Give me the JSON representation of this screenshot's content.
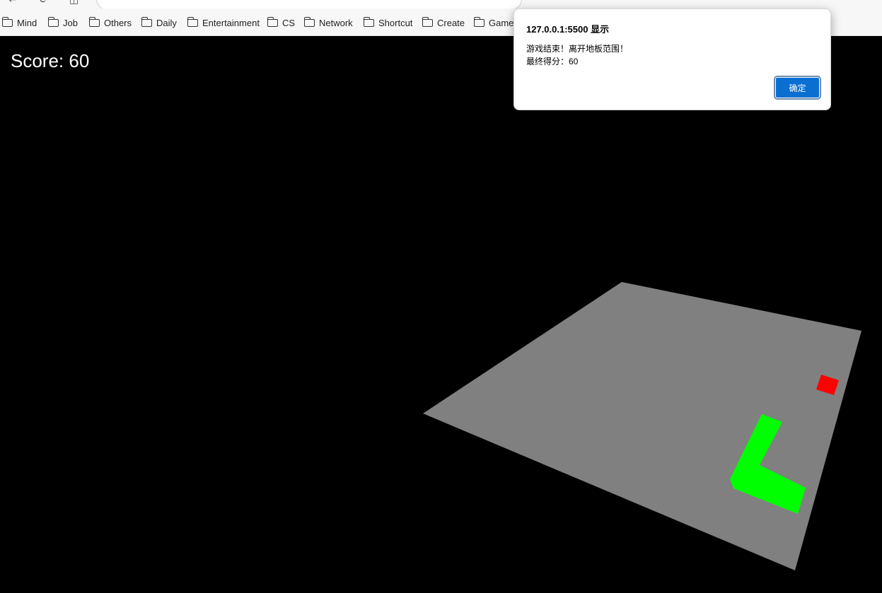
{
  "browser": {
    "bookmarks": [
      "Mind",
      "Job",
      "Others",
      "Daily",
      "Entertainment",
      "CS",
      "Network",
      "Shortcut",
      "Create",
      "Game"
    ]
  },
  "game": {
    "score_text": "Score: 60",
    "colors": {
      "background": "#000000",
      "floor": "#808080",
      "snake": "#00ff00",
      "food": "#ff0000"
    }
  },
  "dialog": {
    "title": "127.0.0.1:5500 显示",
    "message_line1": "游戏结束！离开地板范围！",
    "message_line2": "最终得分：60",
    "ok_label": "确定"
  }
}
